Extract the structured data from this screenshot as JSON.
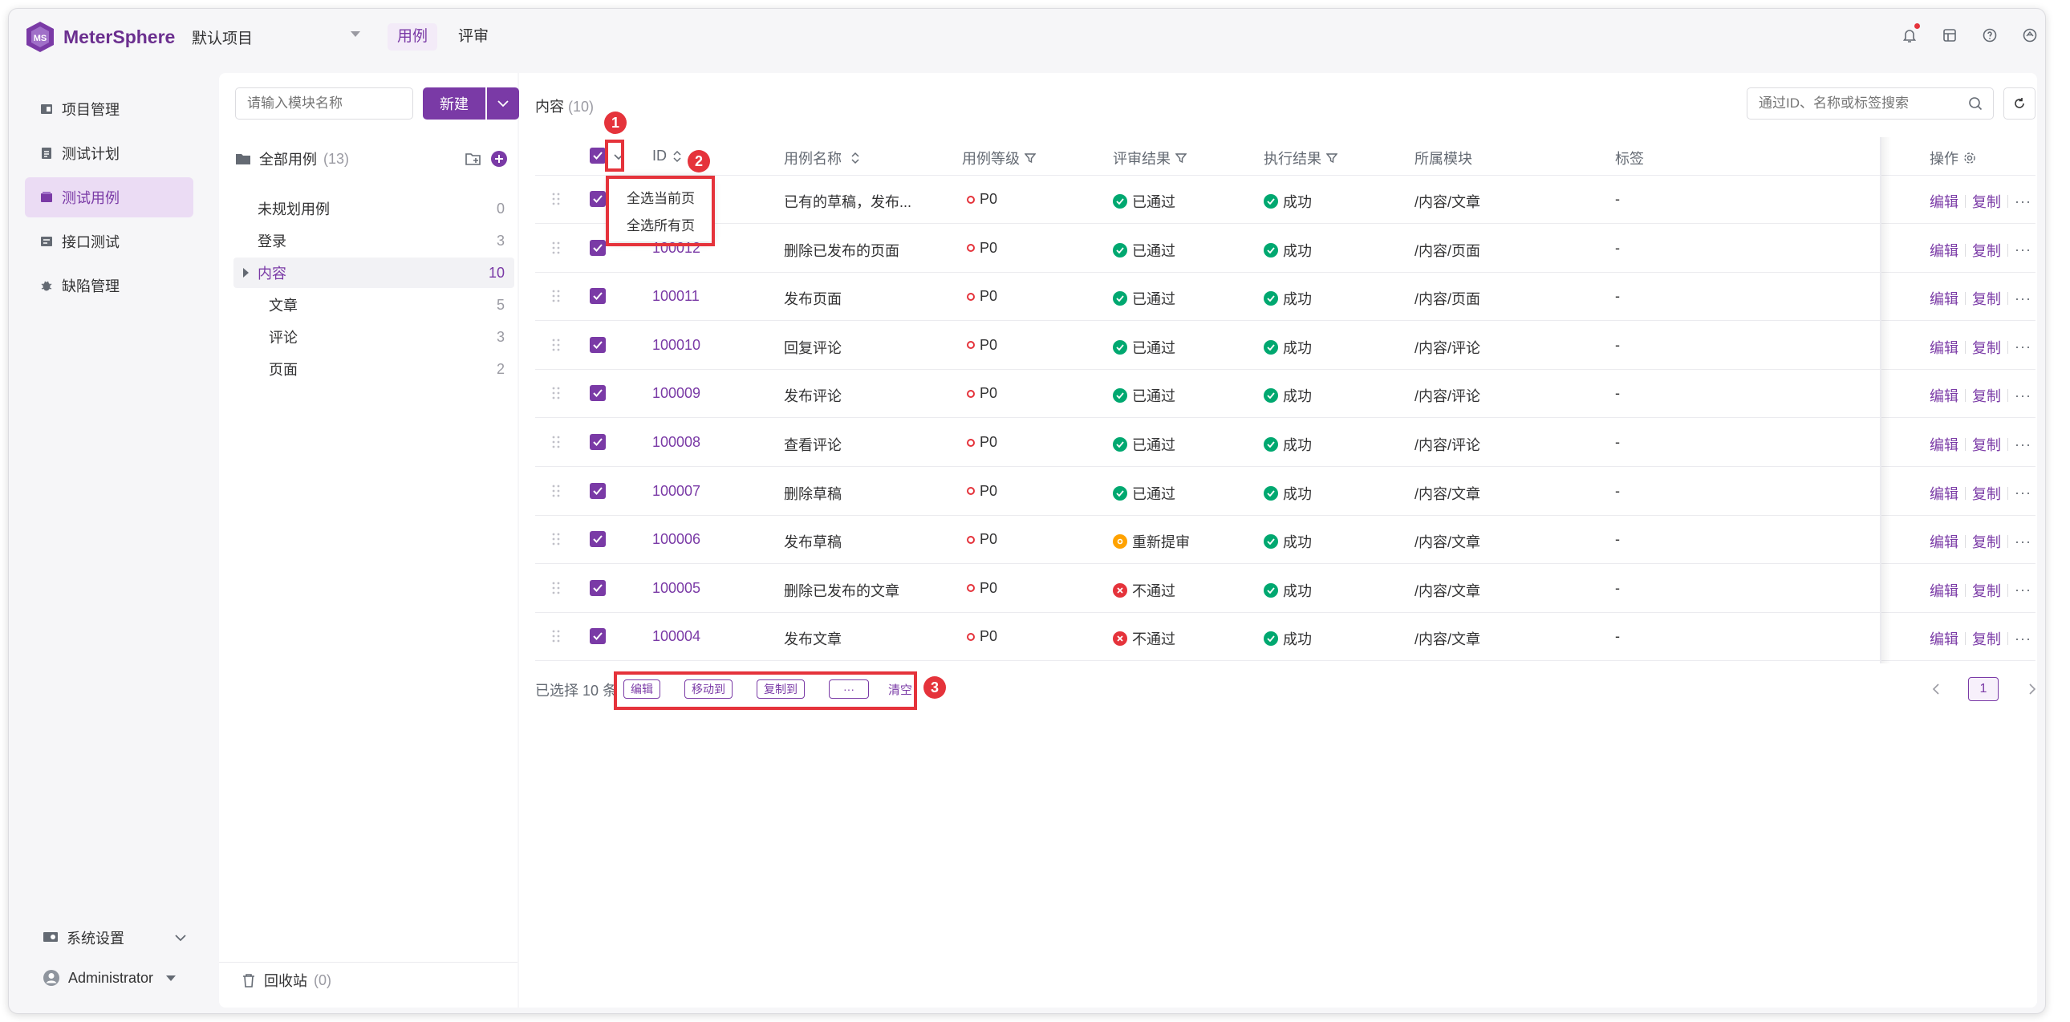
{
  "app": {
    "name": "MeterSphere",
    "project": "默认项目"
  },
  "top_tabs": [
    "用例",
    "评审"
  ],
  "nav": [
    "项目管理",
    "测试计划",
    "测试用例",
    "接口测试",
    "缺陷管理"
  ],
  "nav_bottom": {
    "settings": "系统设置",
    "user": "Administrator"
  },
  "tree": {
    "search_placeholder": "请输入模块名称",
    "new_label": "新建",
    "all_label": "全部用例",
    "all_count": "(13)",
    "nodes": [
      {
        "label": "未规划用例",
        "count": "0"
      },
      {
        "label": "登录",
        "count": "3"
      },
      {
        "label": "内容",
        "count": "10"
      },
      {
        "label": "文章",
        "count": "5"
      },
      {
        "label": "评论",
        "count": "3"
      },
      {
        "label": "页面",
        "count": "2"
      }
    ],
    "recycle_label": "回收站",
    "recycle_count": "(0)"
  },
  "main": {
    "title": "内容",
    "title_count": "(10)",
    "search_placeholder": "通过ID、名称或标签搜索",
    "columns": [
      "ID",
      "用例名称",
      "用例等级",
      "评审结果",
      "执行结果",
      "所属模块",
      "标签",
      "操作"
    ],
    "rows": [
      {
        "id": "",
        "name": "已有的草稿，发布...",
        "level": "P0",
        "review": "已通过",
        "review_status": "pass",
        "exec": "成功",
        "module": "/内容/文章",
        "tags": "-"
      },
      {
        "id": "100012",
        "name": "删除已发布的页面",
        "level": "P0",
        "review": "已通过",
        "review_status": "pass",
        "exec": "成功",
        "module": "/内容/页面",
        "tags": "-"
      },
      {
        "id": "100011",
        "name": "发布页面",
        "level": "P0",
        "review": "已通过",
        "review_status": "pass",
        "exec": "成功",
        "module": "/内容/页面",
        "tags": "-"
      },
      {
        "id": "100010",
        "name": "回复评论",
        "level": "P0",
        "review": "已通过",
        "review_status": "pass",
        "exec": "成功",
        "module": "/内容/评论",
        "tags": "-"
      },
      {
        "id": "100009",
        "name": "发布评论",
        "level": "P0",
        "review": "已通过",
        "review_status": "pass",
        "exec": "成功",
        "module": "/内容/评论",
        "tags": "-"
      },
      {
        "id": "100008",
        "name": "查看评论",
        "level": "P0",
        "review": "已通过",
        "review_status": "pass",
        "exec": "成功",
        "module": "/内容/评论",
        "tags": "-"
      },
      {
        "id": "100007",
        "name": "删除草稿",
        "level": "P0",
        "review": "已通过",
        "review_status": "pass",
        "exec": "成功",
        "module": "/内容/文章",
        "tags": "-"
      },
      {
        "id": "100006",
        "name": "发布草稿",
        "level": "P0",
        "review": "重新提审",
        "review_status": "resubmit",
        "exec": "成功",
        "module": "/内容/文章",
        "tags": "-"
      },
      {
        "id": "100005",
        "name": "删除已发布的文章",
        "level": "P0",
        "review": "不通过",
        "review_status": "fail",
        "exec": "成功",
        "module": "/内容/文章",
        "tags": "-"
      },
      {
        "id": "100004",
        "name": "发布文章",
        "level": "P0",
        "review": "不通过",
        "review_status": "fail",
        "exec": "成功",
        "module": "/内容/文章",
        "tags": "-"
      }
    ],
    "row_ops": {
      "edit": "编辑",
      "copy": "复制",
      "more": "···"
    },
    "dropdown": [
      "全选当前页",
      "全选所有页"
    ],
    "selected_info": "已选择 10 条",
    "batch": [
      "编辑",
      "移动到",
      "复制到",
      "···"
    ],
    "clear": "清空",
    "page": "1"
  },
  "annotations": [
    "1",
    "2",
    "3"
  ],
  "colors": {
    "brand": "#7a3aa6",
    "annotation": "#e5333b",
    "success": "#00a870",
    "warning": "#ffa200",
    "danger": "#e5333b"
  }
}
